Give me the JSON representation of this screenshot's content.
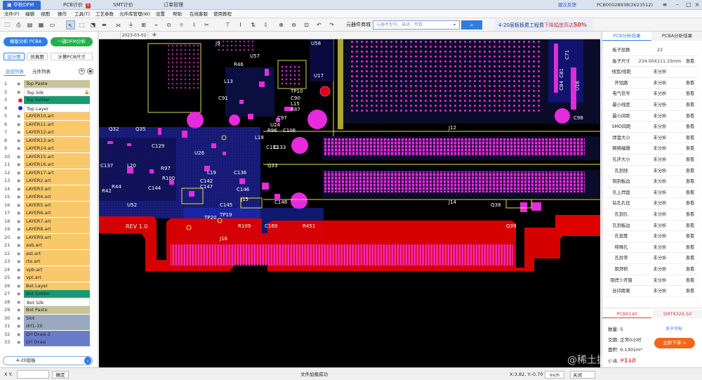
{
  "titlebar": {
    "tabs": [
      {
        "label": "华秋DFM",
        "active": true
      },
      {
        "label": "PCB计价",
        "active": false
      },
      {
        "label": "SMT计价",
        "active": false
      },
      {
        "label": "订单管理",
        "active": false
      }
    ],
    "feedback": "建议反馈",
    "account": "PCB00028938(2623512)"
  },
  "menu": [
    "文件(F)",
    "编辑",
    "视图",
    "操作",
    "工具(T)",
    "工艺参数",
    "元件库管理(W)",
    "设置",
    "帮助",
    "在线客服",
    "使用教程"
  ],
  "toolbar": {
    "component_search_label": "元器件商城",
    "search_placeholder": "元器件型号、描述、参数",
    "banner_text": "4-20层板板费工程费",
    "banner_highlight": "下降幅度高达",
    "banner_percent": "50%"
  },
  "leftpanel": {
    "btn_pcba": "裸版分析 PCBA",
    "btn_dfm": "一键DFM分析",
    "subtabs": [
      "设计图",
      "仿真图",
      "计算PCB尺寸"
    ],
    "list_tabs": [
      "层层列表",
      "元件列表"
    ],
    "layers": [
      {
        "num": "1",
        "name": "Top Paste",
        "color": "#c7c49a",
        "dot": ""
      },
      {
        "num": "2",
        "name": "Top Silk",
        "color": "#ffffff",
        "dot": "",
        "locked": true
      },
      {
        "num": "3",
        "name": "Top Solder",
        "color": "#1a9a72",
        "dot": "#e0262e"
      },
      {
        "num": "4",
        "name": "Top Layer",
        "color": "#ffffff",
        "dot": "#1f2bd1"
      },
      {
        "num": "5",
        "name": "LAYER10.art",
        "color": "#f8c86a",
        "dot": ""
      },
      {
        "num": "6",
        "name": "LAYER11.art",
        "color": "#f8c86a",
        "dot": ""
      },
      {
        "num": "7",
        "name": "LAYER12.art",
        "color": "#f8c86a",
        "dot": ""
      },
      {
        "num": "8",
        "name": "LAYER13.art",
        "color": "#f8c86a",
        "dot": ""
      },
      {
        "num": "9",
        "name": "LAYER14.art",
        "color": "#f8c86a",
        "dot": ""
      },
      {
        "num": "10",
        "name": "LAYER15.art",
        "color": "#f8c86a",
        "dot": ""
      },
      {
        "num": "11",
        "name": "LAYER16.art",
        "color": "#f8c86a",
        "dot": ""
      },
      {
        "num": "12",
        "name": "LAYER17.art",
        "color": "#f8c86a",
        "dot": ""
      },
      {
        "num": "13",
        "name": "LAYER2.art",
        "color": "#f8c86a",
        "dot": ""
      },
      {
        "num": "14",
        "name": "LAYER3.art",
        "color": "#f8c86a",
        "dot": ""
      },
      {
        "num": "15",
        "name": "LAYER4.art",
        "color": "#f8c86a",
        "dot": ""
      },
      {
        "num": "16",
        "name": "LAYER5.art",
        "color": "#f8c86a",
        "dot": ""
      },
      {
        "num": "17",
        "name": "LAYER6.art",
        "color": "#f8c86a",
        "dot": ""
      },
      {
        "num": "18",
        "name": "LAYER7.art",
        "color": "#f8c86a",
        "dot": ""
      },
      {
        "num": "19",
        "name": "LAYER8.art",
        "color": "#f8c86a",
        "dot": ""
      },
      {
        "num": "20",
        "name": "LAYER9.art",
        "color": "#f8c86a",
        "dot": ""
      },
      {
        "num": "21",
        "name": "asb.art",
        "color": "#f8c86a",
        "dot": ""
      },
      {
        "num": "22",
        "name": "ast.art",
        "color": "#f8c86a",
        "dot": ""
      },
      {
        "num": "23",
        "name": "rte.art",
        "color": "#f8c86a",
        "dot": ""
      },
      {
        "num": "24",
        "name": "vpb.art",
        "color": "#f8c86a",
        "dot": ""
      },
      {
        "num": "25",
        "name": "vpt.art",
        "color": "#f8c86a",
        "dot": ""
      },
      {
        "num": "26",
        "name": "Bot Layer",
        "color": "#f8c86a",
        "dot": ""
      },
      {
        "num": "27",
        "name": "Bot Solder",
        "color": "#1a9a72",
        "dot": ""
      },
      {
        "num": "28",
        "name": "Bot Silk",
        "color": "#ffffff",
        "dot": ""
      },
      {
        "num": "29",
        "name": "Bot Paste",
        "color": "#c7c49a",
        "dot": ""
      },
      {
        "num": "30",
        "name": "Slot",
        "color": "#9aa9bf",
        "dot": ""
      },
      {
        "num": "31",
        "name": "drl1-1lt",
        "color": "#9aa9bf",
        "dot": ""
      },
      {
        "num": "32",
        "name": "Drl Draw-2",
        "color": "#6a7bc9",
        "dot": ""
      },
      {
        "num": "33",
        "name": "Drl Draw",
        "color": "#6a7bc9",
        "dot": ""
      }
    ],
    "bottom_select": "4-20层板"
  },
  "canvas": {
    "date_tab": "2023-03-02",
    "labels": [
      "J9",
      "U58",
      "U57",
      "R46",
      "U17",
      "TP10",
      "C90",
      "L15",
      "R87",
      "L13",
      "C91",
      "U24",
      "R96",
      "C106",
      "C97",
      "J12",
      "Q32",
      "Q35",
      "L18",
      "C129",
      "C132",
      "C133",
      "U26",
      "Q33",
      "C137",
      "L20",
      "L19",
      "C136",
      "R42",
      "R44",
      "R97",
      "R100",
      "C144",
      "C142",
      "C147",
      "C146",
      "U52",
      "J15",
      "C148",
      "J14",
      "Q38",
      "Q39",
      "REV 1.0",
      "TP20",
      "TP19",
      "C145",
      "R109",
      "C169",
      "R451",
      "C71",
      "C81",
      "C84",
      "U16",
      "C98",
      "J16"
    ]
  },
  "rightpanel": {
    "tabs": [
      "PCB分析结果",
      "PCBA分析结果"
    ],
    "rows": [
      {
        "label": "板子层数",
        "value": "23",
        "action": ""
      },
      {
        "label": "板子尺寸",
        "value": "234.00X111.15mm",
        "action": "查看"
      },
      {
        "label": "线宽/线距",
        "value": "未分析",
        "action": ""
      },
      {
        "label": "开短路",
        "value": "未分析",
        "action": "查看"
      },
      {
        "label": "电气信号",
        "value": "未分析",
        "action": "查看"
      },
      {
        "label": "最小线宽",
        "value": "未分析",
        "action": "查看"
      },
      {
        "label": "最小间距",
        "value": "未分析",
        "action": "查看"
      },
      {
        "label": "SMD间距",
        "value": "未分析",
        "action": "查看"
      },
      {
        "label": "焊盘大小",
        "value": "未分析",
        "action": "查看"
      },
      {
        "label": "网络编辑",
        "value": "未分析",
        "action": "查看"
      },
      {
        "label": "孔环大小",
        "value": "未分析",
        "action": "查看"
      },
      {
        "label": "孔到线",
        "value": "未分析",
        "action": "查看"
      },
      {
        "label": "铜到板边",
        "value": "未分析",
        "action": "查看"
      },
      {
        "label": "孔上焊盘",
        "value": "未分析",
        "action": "查看"
      },
      {
        "label": "钻孔孔径",
        "value": "未分析",
        "action": "查看"
      },
      {
        "label": "孔到孔",
        "value": "未分析",
        "action": "查看"
      },
      {
        "label": "孔到板边",
        "value": "未分析",
        "action": "查看"
      },
      {
        "label": "孔密度",
        "value": "未分析",
        "action": "查看"
      },
      {
        "label": "特殊孔",
        "value": "未分析",
        "action": "查看"
      },
      {
        "label": "孔异常",
        "value": "未分析",
        "action": "查看"
      },
      {
        "label": "阻焊桥",
        "value": "未分析",
        "action": "查看"
      },
      {
        "label": "阻焊少开窗",
        "value": "未分析",
        "action": "查看"
      },
      {
        "label": "丝印距离",
        "value": "未分析",
        "action": "查看"
      }
    ],
    "price_tabs": [
      "PCB¥140",
      "SMT¥326.50"
    ],
    "qty_label": "数量:",
    "qty_value": "5",
    "delivery_label": "交期:",
    "delivery_value": "正常0小时",
    "area_label": "面积:",
    "area_value": "0.1301m²",
    "price_label": "价格:",
    "price_value": "¥140",
    "about_link": "关于华秋",
    "order_button": "立即下单 >"
  },
  "statusbar": {
    "xy_label": "X Y:",
    "confirm": "确定",
    "message": "文件加载成功",
    "coords": "X:3.82, Y:-0.70",
    "unit": "Inch",
    "toggle": "关闭"
  },
  "watermark": "@稀土掘金技术社区"
}
